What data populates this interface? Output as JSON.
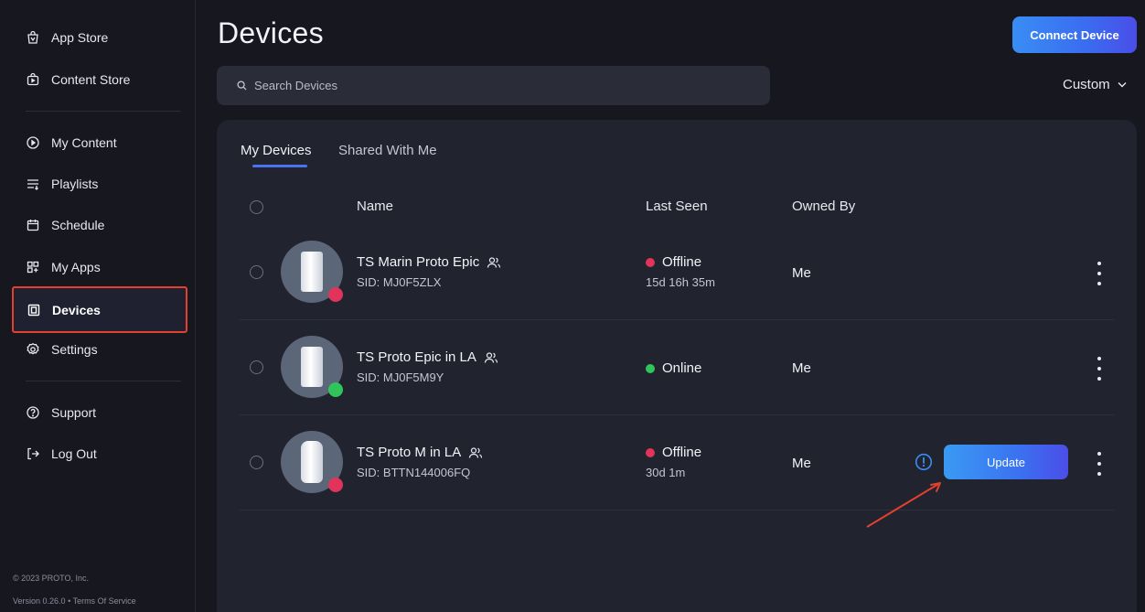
{
  "sidebar": {
    "items": [
      {
        "label": "App Store",
        "icon": "shopping-bag-icon"
      },
      {
        "label": "Content Store",
        "icon": "content-bag-icon"
      },
      {
        "label": "My Content",
        "icon": "play-circle-icon"
      },
      {
        "label": "Playlists",
        "icon": "playlist-icon"
      },
      {
        "label": "Schedule",
        "icon": "calendar-icon"
      },
      {
        "label": "My Apps",
        "icon": "apps-grid-icon"
      },
      {
        "label": "Devices",
        "icon": "device-icon"
      },
      {
        "label": "Settings",
        "icon": "gear-icon"
      },
      {
        "label": "Support",
        "icon": "help-circle-icon"
      },
      {
        "label": "Log Out",
        "icon": "logout-icon"
      }
    ],
    "copyright": "© 2023 PROTO, Inc.",
    "version": "Version 0.26.0",
    "separator": "•",
    "terms": "Terms Of Service"
  },
  "header": {
    "title": "Devices",
    "connect_button": "Connect Device"
  },
  "search": {
    "placeholder": "Search Devices"
  },
  "filter": {
    "selected": "Custom"
  },
  "tabs": [
    {
      "label": "My Devices",
      "active": true
    },
    {
      "label": "Shared With Me",
      "active": false
    }
  ],
  "table": {
    "columns": [
      "Name",
      "Last Seen",
      "Owned By"
    ],
    "rows": [
      {
        "name": "TS Marin Proto Epic",
        "sid": "SID: MJ0F5ZLX",
        "status": "Offline",
        "last_seen": "15d 16h 35m",
        "owner": "Me",
        "status_color": "#e0345a"
      },
      {
        "name": "TS Proto Epic in LA",
        "sid": "SID: MJ0F5M9Y",
        "status": "Online",
        "last_seen": "",
        "owner": "Me",
        "status_color": "#2fc55a"
      },
      {
        "name": "TS Proto M in LA",
        "sid": "SID: BTTN144006FQ",
        "status": "Offline",
        "last_seen": "30d 1m",
        "owner": "Me",
        "status_color": "#e0345a",
        "update_label": "Update"
      }
    ]
  },
  "colors": {
    "background": "#16171f",
    "panel": "#21232f",
    "accent": "#3a7cf2",
    "offline": "#e0345a",
    "online": "#2fc55a",
    "highlight": "#e3412d"
  }
}
